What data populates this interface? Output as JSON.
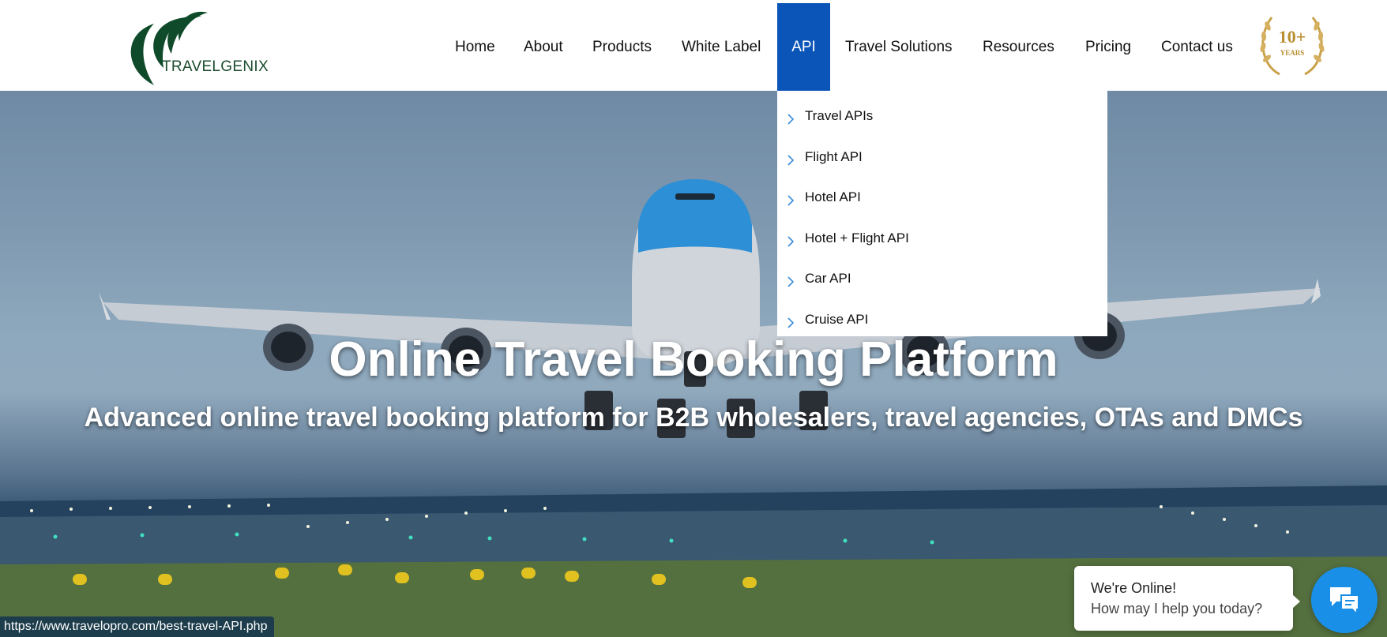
{
  "brand": {
    "name": "TRAVELGENIX",
    "badge_line1": "10+",
    "badge_line2": "YEARS"
  },
  "nav": {
    "items": [
      {
        "label": "Home",
        "active": false
      },
      {
        "label": "About",
        "active": false
      },
      {
        "label": "Products",
        "active": false
      },
      {
        "label": "White Label",
        "active": false
      },
      {
        "label": "API",
        "active": true
      },
      {
        "label": "Travel Solutions",
        "active": false
      },
      {
        "label": "Resources",
        "active": false
      },
      {
        "label": "Pricing",
        "active": false
      },
      {
        "label": "Contact us",
        "active": false
      }
    ]
  },
  "dropdown": {
    "items": [
      {
        "label": "Travel APIs"
      },
      {
        "label": "Flight API"
      },
      {
        "label": "Hotel API"
      },
      {
        "label": "Hotel + Flight API"
      },
      {
        "label": "Car API"
      },
      {
        "label": "Cruise API"
      }
    ],
    "icon": "chevron-right-icon"
  },
  "hero": {
    "title": "Online Travel Booking Platform",
    "subtitle": "Advanced online travel booking platform for B2B wholesalers, travel agencies, OTAs and DMCs"
  },
  "status_bar": {
    "url": "https://www.travelopro.com/best-travel-API.php"
  },
  "chat": {
    "title": "We're Online!",
    "subtitle": "How may I help you today?",
    "icon": "chat-icon"
  },
  "colors": {
    "accent": "#0b54b8",
    "logo_green": "#1b4d2e",
    "chat_blue": "#1a8fe8",
    "badge_gold": "#c9a24a"
  }
}
